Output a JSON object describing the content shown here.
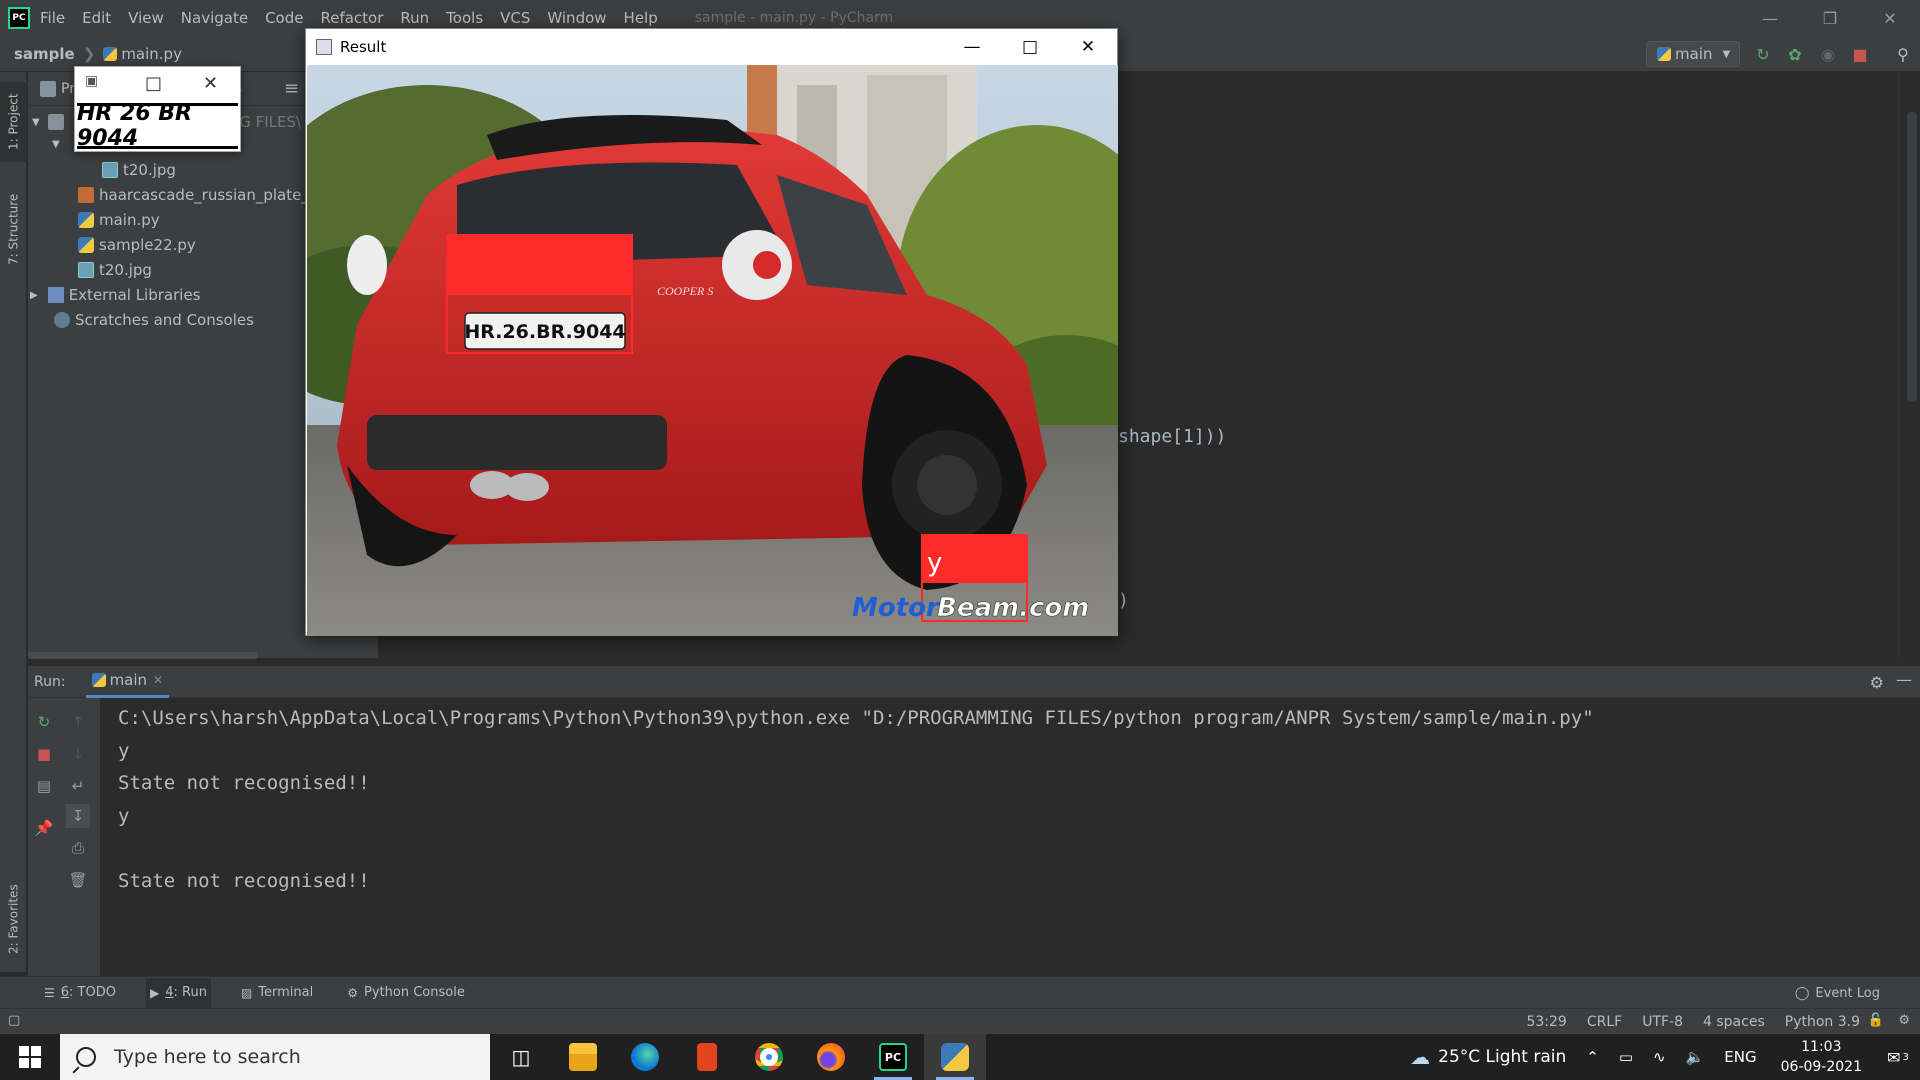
{
  "window": {
    "title": "sample - main.py - PyCharm",
    "menu": [
      "File",
      "Edit",
      "View",
      "Navigate",
      "Code",
      "Refactor",
      "Run",
      "Tools",
      "VCS",
      "Window",
      "Help"
    ],
    "menu_mnemonics": [
      "F",
      "E",
      "V",
      "N",
      "C",
      "R",
      "u",
      "T",
      "S",
      "W",
      "H"
    ]
  },
  "navbar": {
    "project": "sample",
    "file": "main.py",
    "run_config": "main"
  },
  "left_stripe": {
    "project_tab": "1: Project",
    "structure_tab": "7: Structure",
    "favorites_tab": "2: Favorites"
  },
  "project_panel": {
    "header": "Pr",
    "path_fragment": "NG FILES\\",
    "items": [
      {
        "label": "t20.jpg",
        "icon": "image-icon"
      },
      {
        "label": "haarcascade_russian_plate_num",
        "icon": "xml-icon"
      },
      {
        "label": "main.py",
        "icon": "python-file-icon"
      },
      {
        "label": "sample22.py",
        "icon": "python-file-icon"
      },
      {
        "label": "t20.jpg",
        "icon": "image-icon"
      },
      {
        "label": "External Libraries",
        "icon": "library-icon"
      },
      {
        "label": "Scratches and Consoles",
        "icon": "scratch-icon"
      }
    ]
  },
  "editor": {
    "code_fragment_1": "shape[1]))",
    "code_fragment_2": ")"
  },
  "run_panel": {
    "label": "Run:",
    "tab": "main",
    "output": [
      "C:\\Users\\harsh\\AppData\\Local\\Programs\\Python\\Python39\\python.exe \"D:/PROGRAMMING FILES/python program/ANPR System/sample/main.py\"",
      "y",
      "State not recognised!!",
      "y",
      "",
      "State not recognised!!"
    ]
  },
  "bottom_tabs": [
    {
      "num": "6",
      "label": ": TODO"
    },
    {
      "num": "4",
      "label": ": Run"
    },
    {
      "num": "",
      "label": "Terminal"
    },
    {
      "num": "",
      "label": "Python Console"
    }
  ],
  "event_log": "Event Log",
  "statusbar": {
    "position": "53:29",
    "line_sep": "CRLF",
    "encoding": "UTF-8",
    "indent": "4 spaces",
    "interpreter": "Python 3.9"
  },
  "popup": {
    "plate_text": "HR 26 BR 9044"
  },
  "result_window": {
    "title": "Result",
    "plate_text": "HR.26.BR.9044",
    "detected_label": "y",
    "watermark_1": "Motor",
    "watermark_2": "Beam.com",
    "badge": "COOPER S"
  },
  "taskbar": {
    "search_placeholder": "Type here to search",
    "weather": "25°C  Light rain",
    "language": "ENG",
    "time": "11:03",
    "date": "06-09-2021",
    "notifications": "3"
  },
  "colors": {
    "ide_bg": "#2b2b2b",
    "ide_panel": "#3c3f41",
    "accent": "#4a88c7",
    "car_red": "#d42a2a",
    "box_red": "#ff2a2a"
  }
}
